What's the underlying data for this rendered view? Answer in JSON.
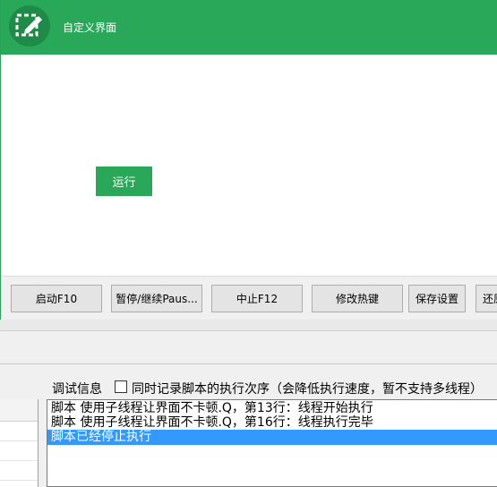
{
  "window": {
    "title": "自定义界面",
    "accent_color": "#2aa85a",
    "icon": "edit-select-icon"
  },
  "main": {
    "run_label": "运行"
  },
  "toolbar": {
    "start_label": "启动F10",
    "pause_label": "暂停/继续Paus...",
    "stop_label": "中止F12",
    "hotkey_label": "修改热键",
    "save_label": "保存设置",
    "restore_label": "还原"
  },
  "debug": {
    "label": "调试信息",
    "record_checkbox_label": "同时记录脚本的执行次序（会降低执行速度，暂不支持多线程）",
    "record_checked": false,
    "log_lines": [
      "脚本 使用子线程让界面不卡顿.Q，第13行：线程开始执行",
      "脚本 使用子线程让界面不卡顿.Q，第16行：线程执行完毕",
      "脚本已经停止执行"
    ],
    "selected_index": 2
  }
}
